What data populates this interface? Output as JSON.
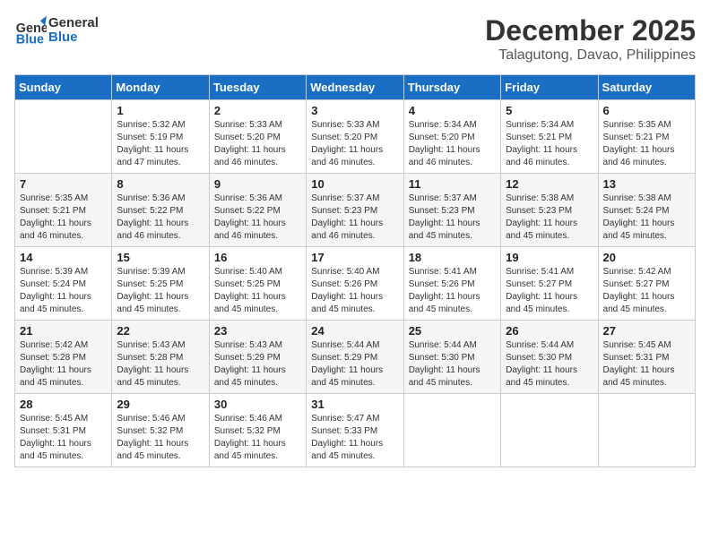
{
  "header": {
    "logo_line1": "General",
    "logo_line2": "Blue",
    "month": "December 2025",
    "location": "Talagutong, Davao, Philippines"
  },
  "days_of_week": [
    "Sunday",
    "Monday",
    "Tuesday",
    "Wednesday",
    "Thursday",
    "Friday",
    "Saturday"
  ],
  "weeks": [
    [
      {
        "day": "",
        "info": ""
      },
      {
        "day": "1",
        "info": "Sunrise: 5:32 AM\nSunset: 5:19 PM\nDaylight: 11 hours\nand 47 minutes."
      },
      {
        "day": "2",
        "info": "Sunrise: 5:33 AM\nSunset: 5:20 PM\nDaylight: 11 hours\nand 46 minutes."
      },
      {
        "day": "3",
        "info": "Sunrise: 5:33 AM\nSunset: 5:20 PM\nDaylight: 11 hours\nand 46 minutes."
      },
      {
        "day": "4",
        "info": "Sunrise: 5:34 AM\nSunset: 5:20 PM\nDaylight: 11 hours\nand 46 minutes."
      },
      {
        "day": "5",
        "info": "Sunrise: 5:34 AM\nSunset: 5:21 PM\nDaylight: 11 hours\nand 46 minutes."
      },
      {
        "day": "6",
        "info": "Sunrise: 5:35 AM\nSunset: 5:21 PM\nDaylight: 11 hours\nand 46 minutes."
      }
    ],
    [
      {
        "day": "7",
        "info": "Sunrise: 5:35 AM\nSunset: 5:21 PM\nDaylight: 11 hours\nand 46 minutes."
      },
      {
        "day": "8",
        "info": "Sunrise: 5:36 AM\nSunset: 5:22 PM\nDaylight: 11 hours\nand 46 minutes."
      },
      {
        "day": "9",
        "info": "Sunrise: 5:36 AM\nSunset: 5:22 PM\nDaylight: 11 hours\nand 46 minutes."
      },
      {
        "day": "10",
        "info": "Sunrise: 5:37 AM\nSunset: 5:23 PM\nDaylight: 11 hours\nand 46 minutes."
      },
      {
        "day": "11",
        "info": "Sunrise: 5:37 AM\nSunset: 5:23 PM\nDaylight: 11 hours\nand 45 minutes."
      },
      {
        "day": "12",
        "info": "Sunrise: 5:38 AM\nSunset: 5:23 PM\nDaylight: 11 hours\nand 45 minutes."
      },
      {
        "day": "13",
        "info": "Sunrise: 5:38 AM\nSunset: 5:24 PM\nDaylight: 11 hours\nand 45 minutes."
      }
    ],
    [
      {
        "day": "14",
        "info": "Sunrise: 5:39 AM\nSunset: 5:24 PM\nDaylight: 11 hours\nand 45 minutes."
      },
      {
        "day": "15",
        "info": "Sunrise: 5:39 AM\nSunset: 5:25 PM\nDaylight: 11 hours\nand 45 minutes."
      },
      {
        "day": "16",
        "info": "Sunrise: 5:40 AM\nSunset: 5:25 PM\nDaylight: 11 hours\nand 45 minutes."
      },
      {
        "day": "17",
        "info": "Sunrise: 5:40 AM\nSunset: 5:26 PM\nDaylight: 11 hours\nand 45 minutes."
      },
      {
        "day": "18",
        "info": "Sunrise: 5:41 AM\nSunset: 5:26 PM\nDaylight: 11 hours\nand 45 minutes."
      },
      {
        "day": "19",
        "info": "Sunrise: 5:41 AM\nSunset: 5:27 PM\nDaylight: 11 hours\nand 45 minutes."
      },
      {
        "day": "20",
        "info": "Sunrise: 5:42 AM\nSunset: 5:27 PM\nDaylight: 11 hours\nand 45 minutes."
      }
    ],
    [
      {
        "day": "21",
        "info": "Sunrise: 5:42 AM\nSunset: 5:28 PM\nDaylight: 11 hours\nand 45 minutes."
      },
      {
        "day": "22",
        "info": "Sunrise: 5:43 AM\nSunset: 5:28 PM\nDaylight: 11 hours\nand 45 minutes."
      },
      {
        "day": "23",
        "info": "Sunrise: 5:43 AM\nSunset: 5:29 PM\nDaylight: 11 hours\nand 45 minutes."
      },
      {
        "day": "24",
        "info": "Sunrise: 5:44 AM\nSunset: 5:29 PM\nDaylight: 11 hours\nand 45 minutes."
      },
      {
        "day": "25",
        "info": "Sunrise: 5:44 AM\nSunset: 5:30 PM\nDaylight: 11 hours\nand 45 minutes."
      },
      {
        "day": "26",
        "info": "Sunrise: 5:44 AM\nSunset: 5:30 PM\nDaylight: 11 hours\nand 45 minutes."
      },
      {
        "day": "27",
        "info": "Sunrise: 5:45 AM\nSunset: 5:31 PM\nDaylight: 11 hours\nand 45 minutes."
      }
    ],
    [
      {
        "day": "28",
        "info": "Sunrise: 5:45 AM\nSunset: 5:31 PM\nDaylight: 11 hours\nand 45 minutes."
      },
      {
        "day": "29",
        "info": "Sunrise: 5:46 AM\nSunset: 5:32 PM\nDaylight: 11 hours\nand 45 minutes."
      },
      {
        "day": "30",
        "info": "Sunrise: 5:46 AM\nSunset: 5:32 PM\nDaylight: 11 hours\nand 45 minutes."
      },
      {
        "day": "31",
        "info": "Sunrise: 5:47 AM\nSunset: 5:33 PM\nDaylight: 11 hours\nand 45 minutes."
      },
      {
        "day": "",
        "info": ""
      },
      {
        "day": "",
        "info": ""
      },
      {
        "day": "",
        "info": ""
      }
    ]
  ]
}
